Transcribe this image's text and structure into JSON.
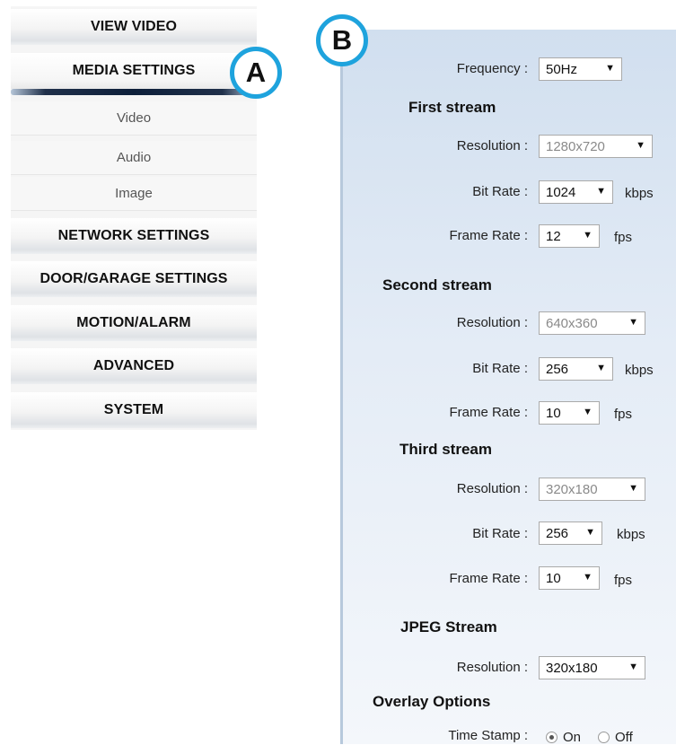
{
  "nav": {
    "view_video": "VIEW VIDEO",
    "media_settings": "MEDIA SETTINGS",
    "sub_video": "Video",
    "sub_audio": "Audio",
    "sub_image": "Image",
    "network_settings": "NETWORK SETTINGS",
    "door_garage_settings": "DOOR/GARAGE SETTINGS",
    "motion_alarm": "MOTION/ALARM",
    "advanced": "ADVANCED",
    "system": "SYSTEM"
  },
  "markers": {
    "a": "A",
    "b": "B"
  },
  "panel": {
    "frequency": {
      "label": "Frequency :",
      "value": "50Hz"
    },
    "first_stream": {
      "title": "First stream",
      "resolution": {
        "label": "Resolution :",
        "value": "1280x720"
      },
      "bit_rate": {
        "label": "Bit Rate :",
        "value": "1024",
        "unit": "kbps"
      },
      "frame_rate": {
        "label": "Frame Rate :",
        "value": "12",
        "unit": "fps"
      }
    },
    "second_stream": {
      "title": "Second stream",
      "resolution": {
        "label": "Resolution :",
        "value": "640x360"
      },
      "bit_rate": {
        "label": "Bit Rate :",
        "value": "256",
        "unit": "kbps"
      },
      "frame_rate": {
        "label": "Frame Rate :",
        "value": "10",
        "unit": "fps"
      }
    },
    "third_stream": {
      "title": "Third stream",
      "resolution": {
        "label": "Resolution :",
        "value": "320x180"
      },
      "bit_rate": {
        "label": "Bit Rate :",
        "value": "256",
        "unit": "kbps"
      },
      "frame_rate": {
        "label": "Frame Rate :",
        "value": "10",
        "unit": "fps"
      }
    },
    "jpeg_stream": {
      "title": "JPEG Stream",
      "resolution": {
        "label": "Resolution :",
        "value": "320x180"
      }
    },
    "overlay": {
      "title": "Overlay Options",
      "time_stamp": {
        "label": "Time Stamp :",
        "on": "On",
        "off": "Off",
        "selected": "On"
      }
    }
  },
  "colors": {
    "marker_ring": "#1ea3dd",
    "active_bar": "#0d1f3a",
    "panel_bg": "#dbe6f2"
  },
  "icons": {
    "dropdown": "dropdown-arrow-icon"
  }
}
